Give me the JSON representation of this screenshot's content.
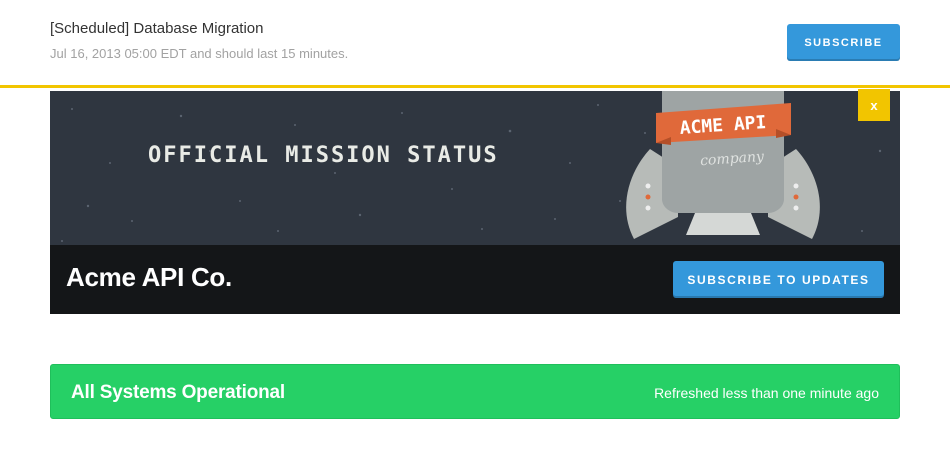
{
  "incident": {
    "title": "[Scheduled] Database Migration",
    "schedule": "Jul 16, 2013 05:00 EDT and should last 15 minutes.",
    "subscribe_label": "SUBSCRIBE"
  },
  "hero": {
    "tagline": "OFFICIAL MISSION STATUS",
    "logo_banner": "ACME API",
    "logo_script": "company",
    "close_label": "x"
  },
  "header": {
    "page_name": "Acme API Co.",
    "subscribe_label": "SUBSCRIBE TO UPDATES"
  },
  "status": {
    "text": "All Systems Operational",
    "refresh": "Refreshed less than one minute ago"
  },
  "colors": {
    "accent_blue": "#3498db",
    "notice_yellow": "#f2c500",
    "operational_green": "#26d066",
    "hero_dark": "#2f3640",
    "logo_orange": "#e0693a"
  }
}
